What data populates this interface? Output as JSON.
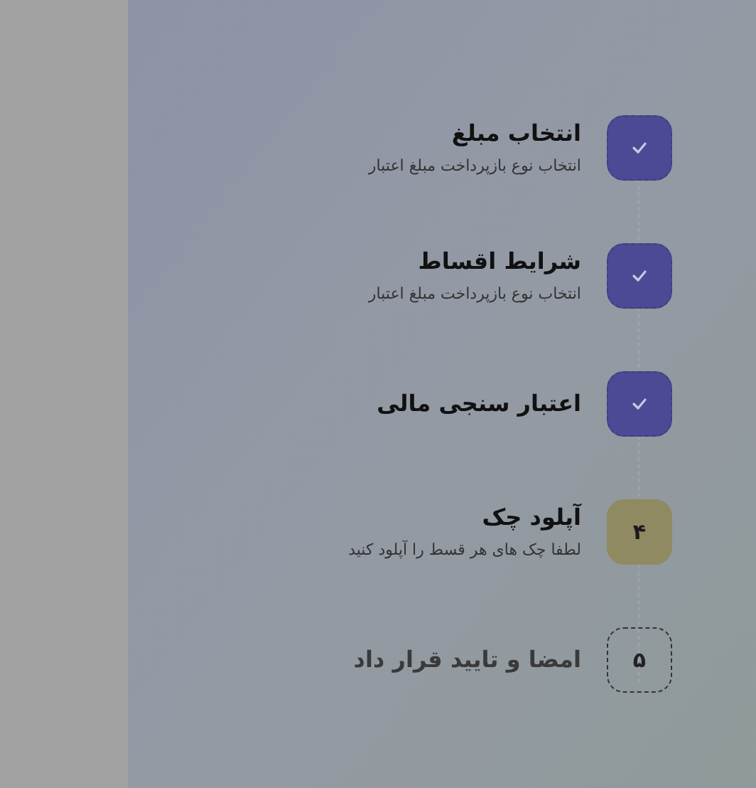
{
  "steps": [
    {
      "title": "انتخاب مبلغ",
      "subtitle": "انتخاب نوع بازپرداخت مبلغ اعتبار",
      "kind": "done"
    },
    {
      "title": "شرایط اقساط",
      "subtitle": "انتخاب نوع بازپرداخت مبلغ اعتبار",
      "kind": "done"
    },
    {
      "title": "اعتبار سنجی مالی",
      "kind": "done"
    },
    {
      "title": "آپلود چک",
      "subtitle": "لطفا چک های هر قسط را آپلود کنید",
      "kind": "current",
      "number": "۴"
    },
    {
      "title": "امضا و تایید قرار داد",
      "kind": "pending",
      "number": "۵"
    }
  ]
}
